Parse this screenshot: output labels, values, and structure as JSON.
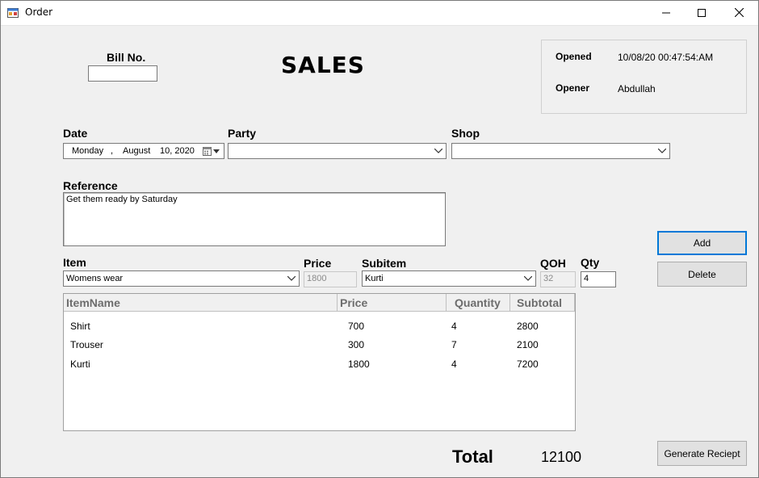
{
  "window": {
    "title": "Order"
  },
  "header": {
    "bill_no_label": "Bill No.",
    "bill_no_value": "",
    "page_title": "SALES"
  },
  "info": {
    "opened_label": "Opened",
    "opened_value": "10/08/20 00:47:54:AM",
    "opener_label": "Opener",
    "opener_value": "Abdullah"
  },
  "form": {
    "date_label": "Date",
    "date_day": "Monday",
    "date_sep": ",",
    "date_month": "August",
    "date_daynum_year": "10, 2020",
    "party_label": "Party",
    "party_value": "",
    "shop_label": "Shop",
    "shop_value": "",
    "reference_label": "Reference",
    "reference_value": "Get them ready by Saturday",
    "item_label": "Item",
    "item_value": "Womens wear",
    "price_label": "Price",
    "price_value": "1800",
    "subitem_label": "Subitem",
    "subitem_value": "Kurti",
    "qoh_label": "QOH",
    "qoh_value": "32",
    "qty_label": "Qty",
    "qty_value": "4"
  },
  "buttons": {
    "add": "Add",
    "delete": "Delete",
    "generate": "Generate Reciept"
  },
  "grid": {
    "columns": [
      "ItemName",
      "Price",
      "Quantity",
      "Subtotal"
    ],
    "rows": [
      {
        "name": "Shirt",
        "price": "700",
        "qty": "4",
        "subtotal": "2800"
      },
      {
        "name": "Trouser",
        "price": "300",
        "qty": "7",
        "subtotal": "2100"
      },
      {
        "name": "Kurti",
        "price": "1800",
        "qty": "4",
        "subtotal": "7200"
      }
    ]
  },
  "total": {
    "label": "Total",
    "value": "12100"
  },
  "icons": {
    "app": "app-window-icon",
    "minimize": "minimize-icon",
    "maximize": "maximize-icon",
    "close": "close-icon",
    "calendar": "calendar-icon",
    "dropdown": "chevron-down-icon"
  }
}
